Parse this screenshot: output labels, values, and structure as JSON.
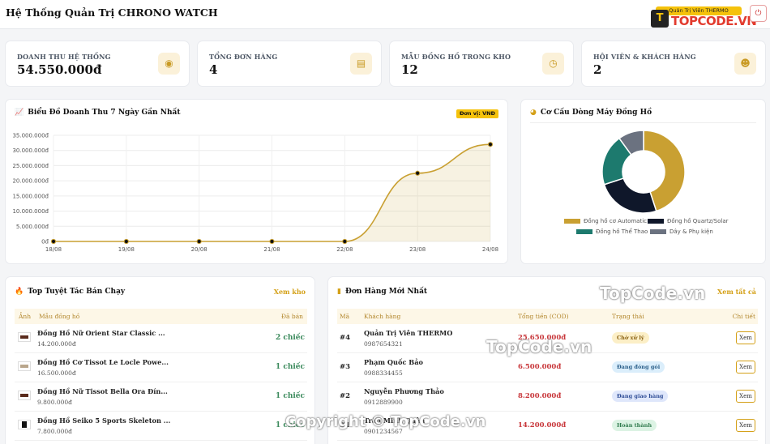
{
  "header": {
    "title": "Hệ Thống Quản Trị CHRONO WATCH",
    "user_label": "Quản Trị Viên THERMO",
    "brand_mark": "T",
    "brand_text": "TOPCODE.VN",
    "logout_icon": "power-icon"
  },
  "kpis": [
    {
      "label": "Doanh thu hệ thống",
      "value": "54.550.000đ",
      "icon": "coins-icon"
    },
    {
      "label": "Tổng đơn hàng",
      "value": "4",
      "icon": "receipt-icon"
    },
    {
      "label": "Mẫu đồng hồ trong kho",
      "value": "12",
      "icon": "clock-icon"
    },
    {
      "label": "Hội viên & khách hàng",
      "value": "2",
      "icon": "users-icon"
    }
  ],
  "revenue_card": {
    "title": "Biểu Đồ Doanh Thu 7 Ngày Gần Nhất",
    "unit_badge": "Đơn vị: VNĐ",
    "icon": "line-chart-icon"
  },
  "structure_card": {
    "title": "Cơ Cấu Dòng Máy Đồng Hồ",
    "icon": "pie-chart-icon"
  },
  "chart_data": [
    {
      "type": "area",
      "title": "Biểu Đồ Doanh Thu 7 Ngày Gần Nhất",
      "x": [
        "18/08",
        "19/08",
        "20/08",
        "21/08",
        "22/08",
        "23/08",
        "24/08"
      ],
      "values": [
        0,
        0,
        0,
        0,
        0,
        22500000,
        32000000
      ],
      "ylim": [
        0,
        35000000
      ],
      "yticks": [
        "35.000.000đ",
        "30.000.000đ",
        "25.000.000đ",
        "20.000.000đ",
        "15.000.000đ",
        "10.000.000đ",
        "5.000.000đ",
        "0đ"
      ],
      "grid": true,
      "color": "#c9a032"
    },
    {
      "type": "pie",
      "title": "Cơ Cấu Dòng Máy Đồng Hồ",
      "categories": [
        "Đồng hồ cơ Automatic",
        "Đồng hồ Quartz/Solar",
        "Đồng hồ Thể Thao",
        "Dây & Phụ kiện"
      ],
      "values": [
        45,
        25,
        20,
        10
      ],
      "colors": [
        "#c9a032",
        "#0f172a",
        "#1d7a6e",
        "#6b7280"
      ],
      "legend": "bottom"
    }
  ],
  "top_products": {
    "title": "Top Tuyệt Tác Bán Chạy",
    "link": "Xem kho",
    "icon": "fire-icon",
    "columns": [
      "Ảnh",
      "Mẫu đồng hồ",
      "Đã bán"
    ],
    "rows": [
      {
        "name": "Đồng Hồ Nữ Orient Star Classic ...",
        "price": "14.200.000đ",
        "sold": "2 chiếc"
      },
      {
        "name": "Đồng Hồ Cơ Tissot Le Locle Powe...",
        "price": "16.500.000đ",
        "sold": "1 chiếc"
      },
      {
        "name": "Đồng Hồ Nữ Tissot Bella Ora Đín...",
        "price": "9.800.000đ",
        "sold": "1 chiếc"
      },
      {
        "name": "Đồng Hồ Seiko 5 Sports Skeleton ...",
        "price": "7.800.000đ",
        "sold": "1 chiếc"
      }
    ]
  },
  "orders": {
    "title": "Đơn Hàng Mới Nhất",
    "link": "Xem tất cả",
    "icon": "receipt-icon",
    "columns": [
      "Mã",
      "Khách hàng",
      "Tổng tiền (COD)",
      "Trạng thái",
      "Chi tiết"
    ],
    "rows": [
      {
        "id": "#4",
        "name": "Quản Trị Viên THERMO",
        "phone": "0987654321",
        "total": "25.650.000đ",
        "status": "Chờ xử lý",
        "status_color": "#fcefc7",
        "status_text_color": "#8a6110",
        "action": "Xem"
      },
      {
        "id": "#3",
        "name": "Phạm Quốc Bảo",
        "phone": "0988334455",
        "total": "6.500.000đ",
        "status": "Đang đóng gói",
        "status_color": "#dbeefb",
        "status_text_color": "#2a5f8a",
        "action": "Xem"
      },
      {
        "id": "#2",
        "name": "Nguyễn Phương Thảo",
        "phone": "0912889900",
        "total": "8.200.000đ",
        "status": "Đang giao hàng",
        "status_color": "#dfe7fb",
        "status_text_color": "#2f4d96",
        "action": "Xem"
      },
      {
        "id": "#1",
        "name": "Trần Minh Quân",
        "phone": "0901234567",
        "total": "14.200.000đ",
        "status": "Hoàn thành",
        "status_color": "#dcf3e4",
        "status_text_color": "#2f7a4d",
        "action": "Xem"
      }
    ]
  },
  "watermarks": [
    "TopCode.vn",
    "TopCode.vn",
    "Copyright © TopCode.vn"
  ]
}
